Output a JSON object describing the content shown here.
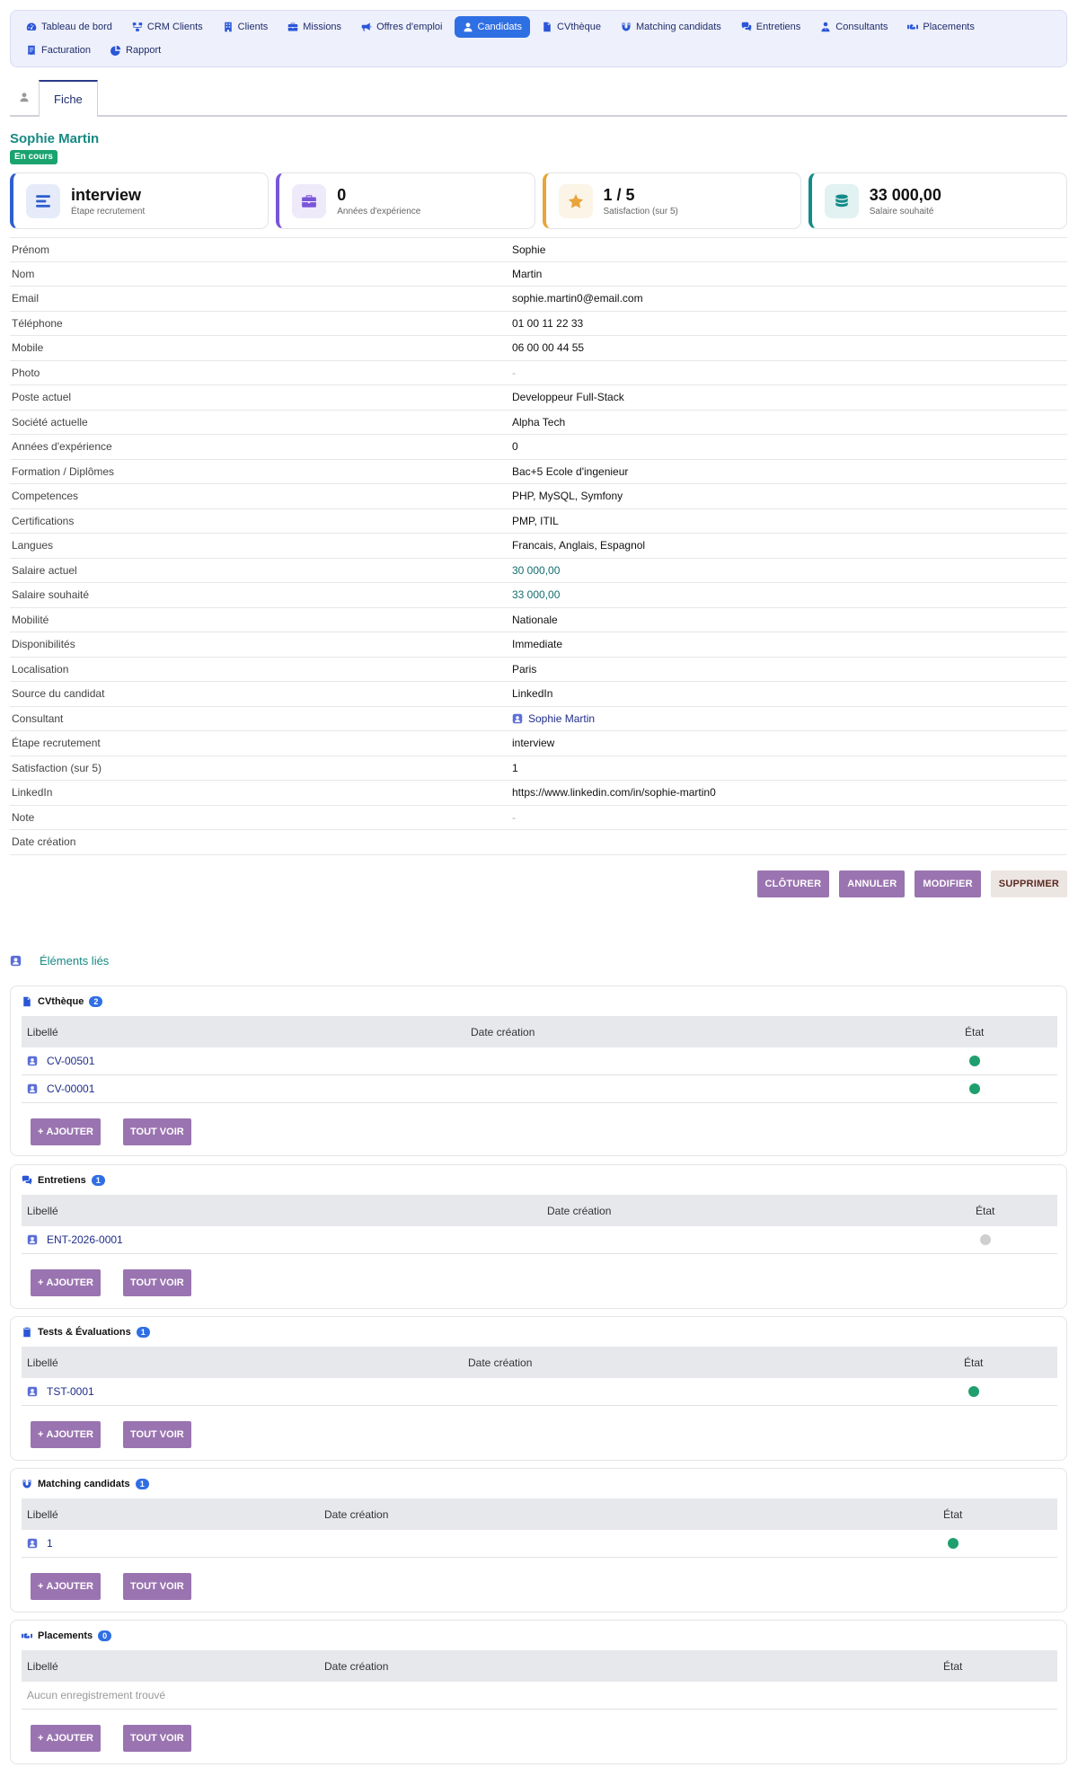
{
  "nav": [
    {
      "label": "Tableau de bord",
      "icon": "dashboard-icon"
    },
    {
      "label": "CRM Clients",
      "icon": "network-icon"
    },
    {
      "label": "Clients",
      "icon": "building-icon"
    },
    {
      "label": "Missions",
      "icon": "briefcase-icon"
    },
    {
      "label": "Offres d'emploi",
      "icon": "megaphone-icon"
    },
    {
      "label": "Candidats",
      "icon": "user-icon",
      "active": true
    },
    {
      "label": "CVthèque",
      "icon": "document-icon"
    },
    {
      "label": "Matching candidats",
      "icon": "magnet-icon"
    },
    {
      "label": "Entretiens",
      "icon": "chat-icon"
    },
    {
      "label": "Consultants",
      "icon": "consultant-icon"
    },
    {
      "label": "Placements",
      "icon": "handshake-icon"
    },
    {
      "label": "Facturation",
      "icon": "invoice-icon"
    },
    {
      "label": "Rapport",
      "icon": "pie-chart-icon"
    }
  ],
  "tabs": {
    "fiche": "Fiche"
  },
  "record": {
    "name": "Sophie Martin",
    "status": "En cours"
  },
  "kpis": [
    {
      "value": "interview",
      "label": "Étape recrutement",
      "color": "#2f5ecf",
      "icon": "bars-icon"
    },
    {
      "value": "0",
      "label": "Années d'expérience",
      "color": "#7a55d9",
      "icon": "briefcase-icon"
    },
    {
      "value": "1 / 5",
      "label": "Satisfaction (sur 5)",
      "color": "#e9a43a",
      "icon": "star-icon"
    },
    {
      "value": "33 000,00",
      "label": "Salaire souhaité",
      "color": "#148b8a",
      "icon": "coins-icon"
    }
  ],
  "fields": [
    {
      "label": "Prénom",
      "value": "Sophie"
    },
    {
      "label": "Nom",
      "value": "Martin"
    },
    {
      "label": "Email",
      "value": "sophie.martin0@email.com"
    },
    {
      "label": "Téléphone",
      "value": "01 00 11 22 33"
    },
    {
      "label": "Mobile",
      "value": "06 00 00 44 55"
    },
    {
      "label": "Photo",
      "value": "-",
      "kind": "dash"
    },
    {
      "label": "Poste actuel",
      "value": "Developpeur Full-Stack"
    },
    {
      "label": "Société actuelle",
      "value": "Alpha Tech"
    },
    {
      "label": "Années d'expérience",
      "value": "0"
    },
    {
      "label": "Formation / Diplômes",
      "value": "Bac+5 Ecole d'ingenieur"
    },
    {
      "label": "Competences",
      "value": "PHP, MySQL, Symfony"
    },
    {
      "label": "Certifications",
      "value": "PMP, ITIL"
    },
    {
      "label": "Langues",
      "value": "Francais, Anglais, Espagnol"
    },
    {
      "label": "Salaire actuel",
      "value": "30 000,00",
      "kind": "money"
    },
    {
      "label": "Salaire souhaité",
      "value": "33 000,00",
      "kind": "money"
    },
    {
      "label": "Mobilité",
      "value": "Nationale"
    },
    {
      "label": "Disponibilités",
      "value": "Immediate"
    },
    {
      "label": "Localisation",
      "value": "Paris"
    },
    {
      "label": "Source du candidat",
      "value": "LinkedIn"
    },
    {
      "label": "Consultant",
      "value": "Sophie Martin",
      "kind": "link"
    },
    {
      "label": "Étape recrutement",
      "value": "interview"
    },
    {
      "label": "Satisfaction (sur 5)",
      "value": "1"
    },
    {
      "label": "LinkedIn",
      "value": "https://www.linkedin.com/in/sophie-martin0"
    },
    {
      "label": "Note",
      "value": "-",
      "kind": "dash"
    },
    {
      "label": "Date création",
      "value": ""
    }
  ],
  "actions": {
    "cloturer": "CLÔTURER",
    "annuler": "ANNULER",
    "modifier": "MODIFIER",
    "supprimer": "SUPPRIMER"
  },
  "linked": {
    "title": "Éléments liés",
    "col_libelle": "Libellé",
    "col_date": "Date création",
    "col_etat": "État",
    "add_label": "AJOUTER",
    "view_all_label": "TOUT VOIR",
    "empty_text": "Aucun enregistrement trouvé",
    "panels": [
      {
        "title": "CVthèque",
        "count": "2",
        "icon": "document-icon",
        "rows": [
          {
            "label": "CV-00501",
            "state": "#1f9e6e"
          },
          {
            "label": "CV-00001",
            "state": "#1f9e6e"
          }
        ]
      },
      {
        "title": "Entretiens",
        "count": "1",
        "icon": "chat-icon",
        "rows": [
          {
            "label": "ENT-2026-0001",
            "state": "#cfcfcf"
          }
        ]
      },
      {
        "title": "Tests & Évaluations",
        "count": "1",
        "icon": "clipboard-check-icon",
        "rows": [
          {
            "label": "TST-0001",
            "state": "#1f9e6e"
          }
        ]
      },
      {
        "title": "Matching candidats",
        "count": "1",
        "icon": "magnet-icon",
        "rows": [
          {
            "label": "1",
            "state": "#1f9e6e"
          }
        ]
      },
      {
        "title": "Placements",
        "count": "0",
        "icon": "handshake-icon",
        "rows": []
      }
    ]
  }
}
